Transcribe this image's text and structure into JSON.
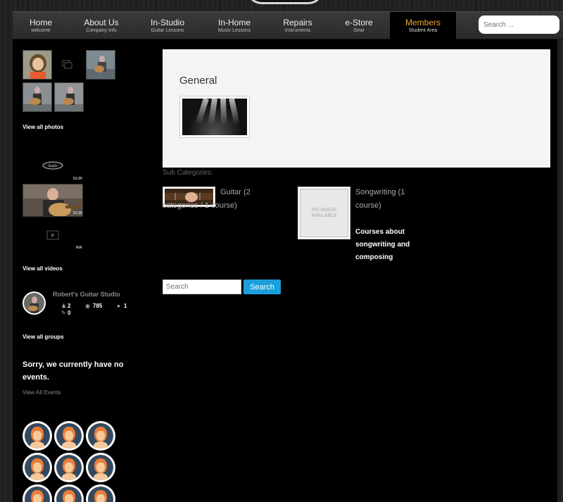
{
  "nav": {
    "items": [
      {
        "label": "Home",
        "sub": "welcome"
      },
      {
        "label": "About Us",
        "sub": "Company Info"
      },
      {
        "label": "In-Studio",
        "sub": "Guitar Lessons"
      },
      {
        "label": "In-Home",
        "sub": "Music Lessons"
      },
      {
        "label": "Repairs",
        "sub": "Instruments"
      },
      {
        "label": "e-Store",
        "sub": "Gear"
      },
      {
        "label": "Members",
        "sub": "Student Area"
      }
    ],
    "search_placeholder": "Search ..."
  },
  "sidebar": {
    "view_all_photos": "View all photos",
    "videos": [
      {
        "duration": "01:20"
      },
      {
        "duration": "01:35"
      },
      {
        "duration": "N/A"
      }
    ],
    "view_all_videos": "View all videos",
    "group": {
      "name": "Robert's Guitar Studio",
      "members": "2",
      "views": "785",
      "comments": "1",
      "posts": "0"
    },
    "view_all_groups": "View all groups",
    "events_message": "Sorry, we currently have no events.",
    "view_all_events": "View All Events"
  },
  "content": {
    "category_title": "General",
    "subcategories_label": "Sub Categories:",
    "subcategories": [
      {
        "name": "Guitar (2 categories / 1 course)",
        "description": ""
      },
      {
        "name": "Songwriting (1 course)",
        "description": "Courses about songwriting and composing",
        "placeholder": "NO IMAGE AVAILABLE"
      }
    ],
    "search_placeholder": "Search",
    "search_button": "Search"
  },
  "colors": {
    "accent": "#f0a830",
    "search_button": "#1a9fdb",
    "avatar_bg": "#34495e"
  }
}
